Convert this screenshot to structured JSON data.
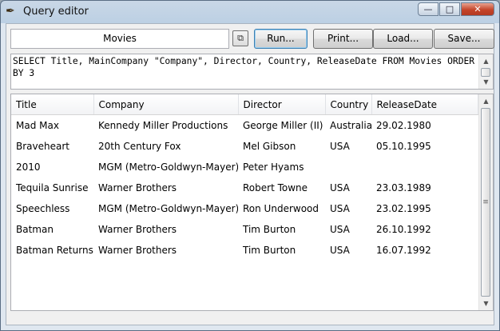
{
  "window": {
    "title": "Query editor",
    "minimize": "—",
    "maximize": "□",
    "close": "✕"
  },
  "toolbar": {
    "name_value": "Movies",
    "small_button_icon": "⧉",
    "run_label": "Run...",
    "print_label": "Print...",
    "load_label": "Load...",
    "save_label": "Save..."
  },
  "query": {
    "text": "SELECT Title, MainCompany \"Company\", Director, Country, ReleaseDate FROM Movies ORDER BY 3"
  },
  "grid": {
    "columns": [
      "Title",
      "Company",
      "Director",
      "Country",
      "ReleaseDate"
    ],
    "rows": [
      [
        "Mad Max",
        "Kennedy Miller Productions",
        "George Miller (II)",
        "Australia",
        "29.02.1980"
      ],
      [
        "Braveheart",
        "20th Century Fox",
        "Mel Gibson",
        "USA",
        "05.10.1995"
      ],
      [
        "2010",
        "MGM (Metro-Goldwyn-Mayer)",
        "Peter Hyams",
        "",
        ""
      ],
      [
        "Tequila Sunrise",
        "Warner Brothers",
        "Robert Towne",
        "USA",
        "23.03.1989"
      ],
      [
        "Speechless",
        "MGM (Metro-Goldwyn-Mayer)",
        "Ron Underwood",
        "USA",
        "23.02.1995"
      ],
      [
        "Batman",
        "Warner Brothers",
        "Tim Burton",
        "USA",
        "26.10.1992"
      ],
      [
        "Batman Returns",
        "Warner Brothers",
        "Tim Burton",
        "USA",
        "16.07.1992"
      ]
    ]
  },
  "icons": {
    "app": "feather-pen-icon",
    "grip": "≡",
    "up": "▲",
    "down": "▼"
  }
}
